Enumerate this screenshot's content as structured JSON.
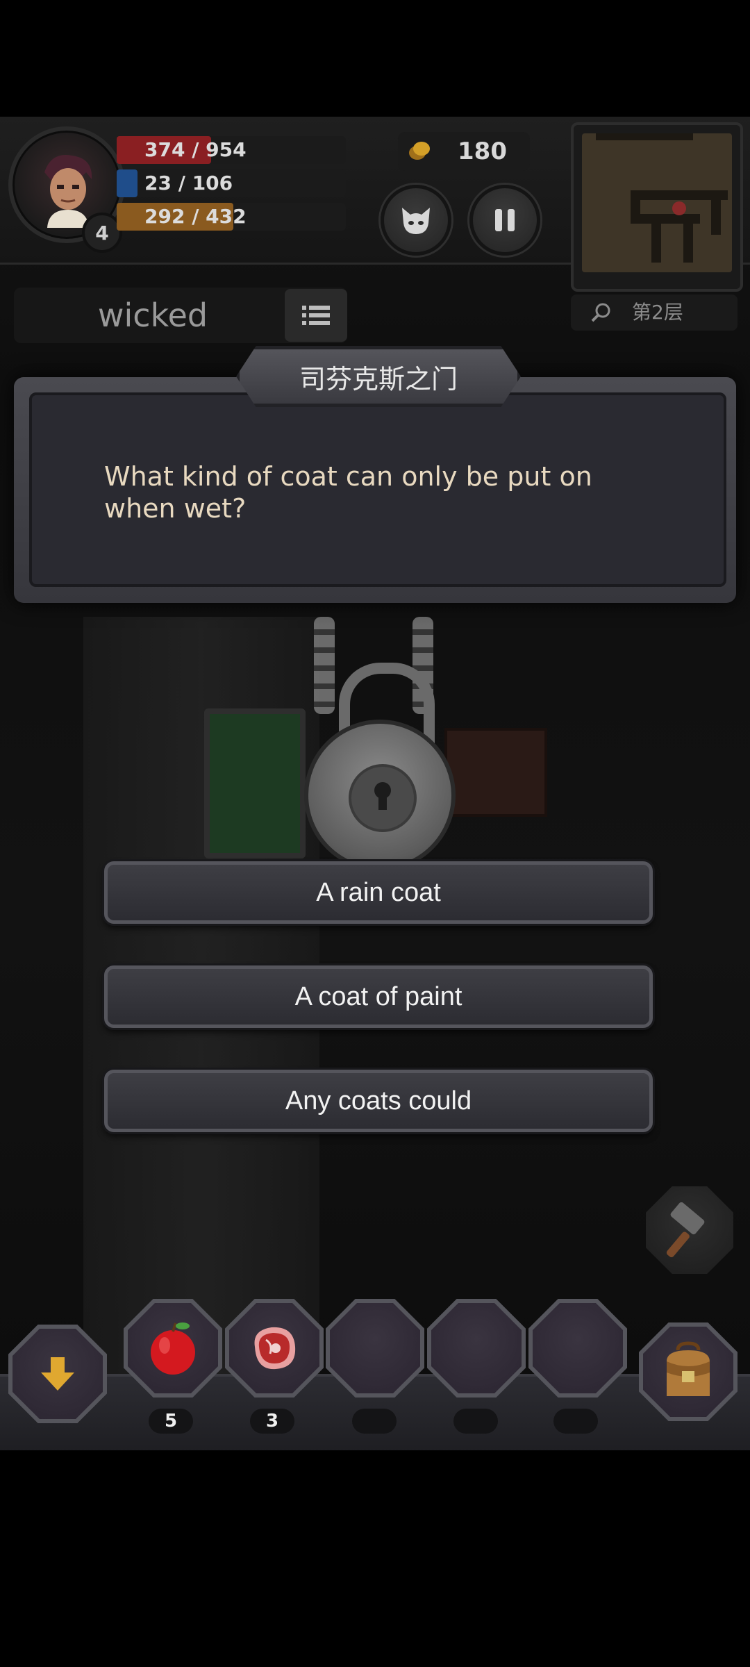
{
  "hud": {
    "hp": "374 / 954",
    "mp": "23 / 106",
    "exp": "292 / 432",
    "level": "4",
    "coins": "180",
    "floor_label": "第2层",
    "player_name": "wicked",
    "colors": {
      "hp": "#8a1f22",
      "mp": "#1f4d8a",
      "exp": "#8a5a1f"
    }
  },
  "dialog": {
    "title": "司芬克斯之门",
    "question": "What kind of coat can only be put on when wet?"
  },
  "answers": [
    {
      "label": "A rain coat"
    },
    {
      "label": "A coat of paint"
    },
    {
      "label": "Any coats could"
    }
  ],
  "bottom": {
    "items": [
      {
        "icon": "apple-icon",
        "count": "5"
      },
      {
        "icon": "meat-icon",
        "count": "3"
      },
      {
        "icon": "empty-slot",
        "count": ""
      },
      {
        "icon": "empty-slot",
        "count": ""
      },
      {
        "icon": "empty-slot",
        "count": ""
      }
    ]
  },
  "icons": {
    "descend": "down-arrow-icon",
    "bag": "backpack-icon",
    "hammer": "hammer-icon",
    "pet": "cat-face-icon",
    "pause": "pause-icon",
    "search": "search-icon",
    "menu": "list-icon",
    "coin": "coin-icon"
  }
}
